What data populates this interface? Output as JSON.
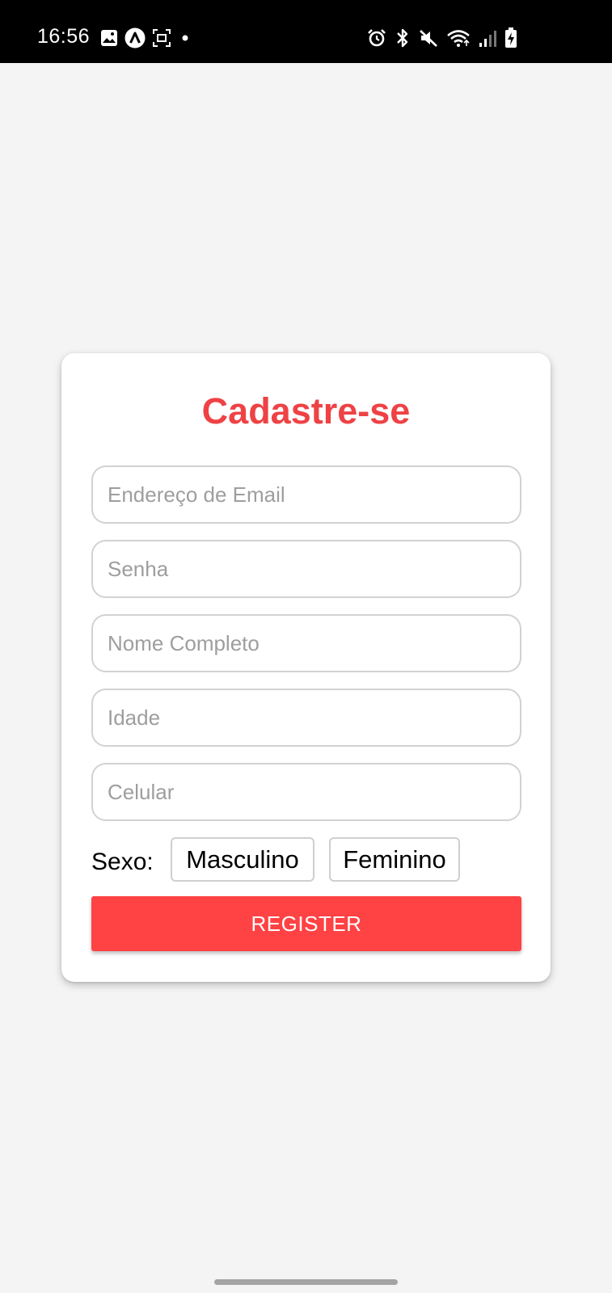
{
  "status_bar": {
    "time": "16:56",
    "left_icons": [
      "image-icon",
      "app-a-icon",
      "screenshot-icon",
      "notification-dot-icon"
    ],
    "right_icons": [
      "alarm-icon",
      "bluetooth-icon",
      "mute-icon",
      "wifi-icon",
      "signal-icon",
      "battery-charging-icon"
    ]
  },
  "form": {
    "title": "Cadastre-se",
    "fields": {
      "email_placeholder": "Endereço de Email",
      "email_value": "",
      "password_placeholder": "Senha",
      "password_value": "",
      "full_name_placeholder": "Nome Completo",
      "full_name_value": "",
      "age_placeholder": "Idade",
      "age_value": "",
      "phone_placeholder": "Celular",
      "phone_value": ""
    },
    "sex_label": "Sexo:",
    "sex_options": {
      "male": "Masculino",
      "female": "Feminino"
    },
    "register_label": "REGISTER"
  },
  "colors": {
    "accent": "#ee4245",
    "button": "#ff4244",
    "background": "#f4f4f4",
    "card": "#ffffff"
  }
}
